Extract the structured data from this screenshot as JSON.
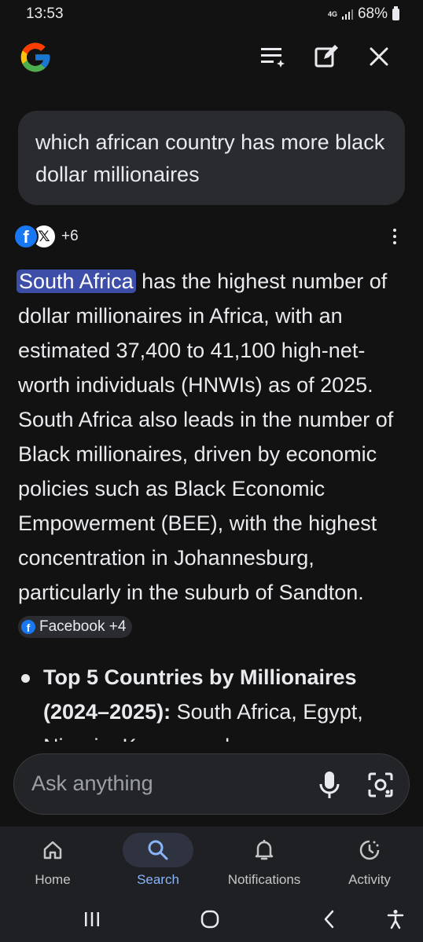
{
  "status_bar": {
    "time": "13:53",
    "network": "4G",
    "battery": "68%"
  },
  "query": {
    "text": "which african country has more black dollar millionaires"
  },
  "sources": {
    "more_count": "+6"
  },
  "answer": {
    "highlight": "South Africa",
    "body": " has the highest number of dollar millionaires in Africa, with an estimated 37,400 to 41,100 high-net-worth individuals (HNWIs) as of 2025. South Africa also leads in the number of Black millionaires, driven by economic policies such as Black Economic Empowerment (BEE), with the highest concentration in Johannesburg, particularly in the suburb of Sandton. ",
    "citation_chip": "Facebook +4"
  },
  "bullet": {
    "bold": "Top 5 Countries by Millionaires (2024–2025):",
    "text": " South Africa, Egypt, Nigeria, Kenya, and"
  },
  "ask_bar": {
    "placeholder": "Ask anything"
  },
  "bottom_nav": {
    "items": [
      {
        "label": "Home",
        "icon": "home-icon"
      },
      {
        "label": "Search",
        "icon": "search-icon",
        "active": true
      },
      {
        "label": "Notifications",
        "icon": "bell-icon"
      },
      {
        "label": "Activity",
        "icon": "activity-icon"
      }
    ]
  },
  "colors": {
    "background": "#121212",
    "highlight": "#3c4ea8",
    "active_nav": "#8ab4f8"
  }
}
